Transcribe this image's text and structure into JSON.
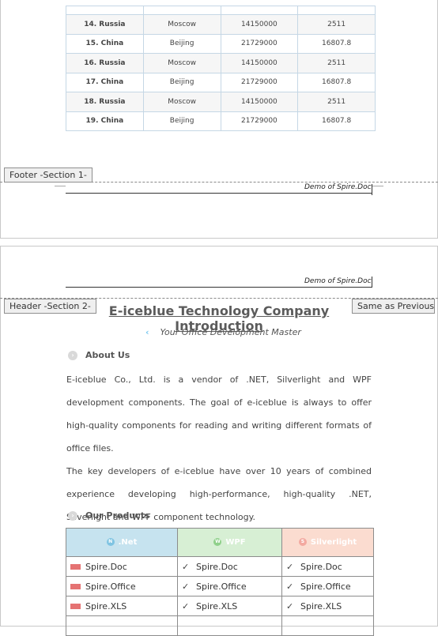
{
  "data_table": {
    "rows": [
      [
        "14. Russia",
        "Moscow",
        "14150000",
        "2511"
      ],
      [
        "15. China",
        "Beijing",
        "21729000",
        "16807.8"
      ],
      [
        "16. Russia",
        "Moscow",
        "14150000",
        "2511"
      ],
      [
        "17. China",
        "Beijing",
        "21729000",
        "16807.8"
      ],
      [
        "18. Russia",
        "Moscow",
        "14150000",
        "2511"
      ],
      [
        "19. China",
        "Beijing",
        "21729000",
        "16807.8"
      ]
    ]
  },
  "footer": {
    "tab_label": "Footer -Section 1-",
    "text": "Demo of Spire.Doc"
  },
  "header": {
    "tab_label": "Header -Section 2-",
    "text": "Demo of Spire.Doc",
    "same_as_previous": "Same as Previous"
  },
  "doc": {
    "title": "E-iceblue Technology Company Introduction",
    "subtitle": "Your Office Development Master",
    "about_heading": "About Us",
    "about_p1": "E-iceblue Co., Ltd. is a vendor of .NET, Silverlight and WPF development components. The goal of e-iceblue is always to offer high-quality components for reading and writing different formats of office files.",
    "about_p2": "The key developers of e-iceblue have over 10 years of combined experience developing high-performance, high-quality .NET, Silverlight and WPF component technology.",
    "products_heading": "Our Products"
  },
  "products": {
    "headers": [
      ".Net",
      "WPF",
      "Silverlight"
    ],
    "header_colors": [
      "#c6e3ef",
      "#d7efd4",
      "#fbdcd0"
    ],
    "rows": [
      [
        "Spire.Doc",
        "Spire.Doc",
        "Spire.Doc"
      ],
      [
        "Spire.Office",
        "Spire.Office",
        "Spire.Office"
      ],
      [
        "Spire.XLS",
        "Spire.XLS",
        "Spire.XLS"
      ]
    ]
  }
}
